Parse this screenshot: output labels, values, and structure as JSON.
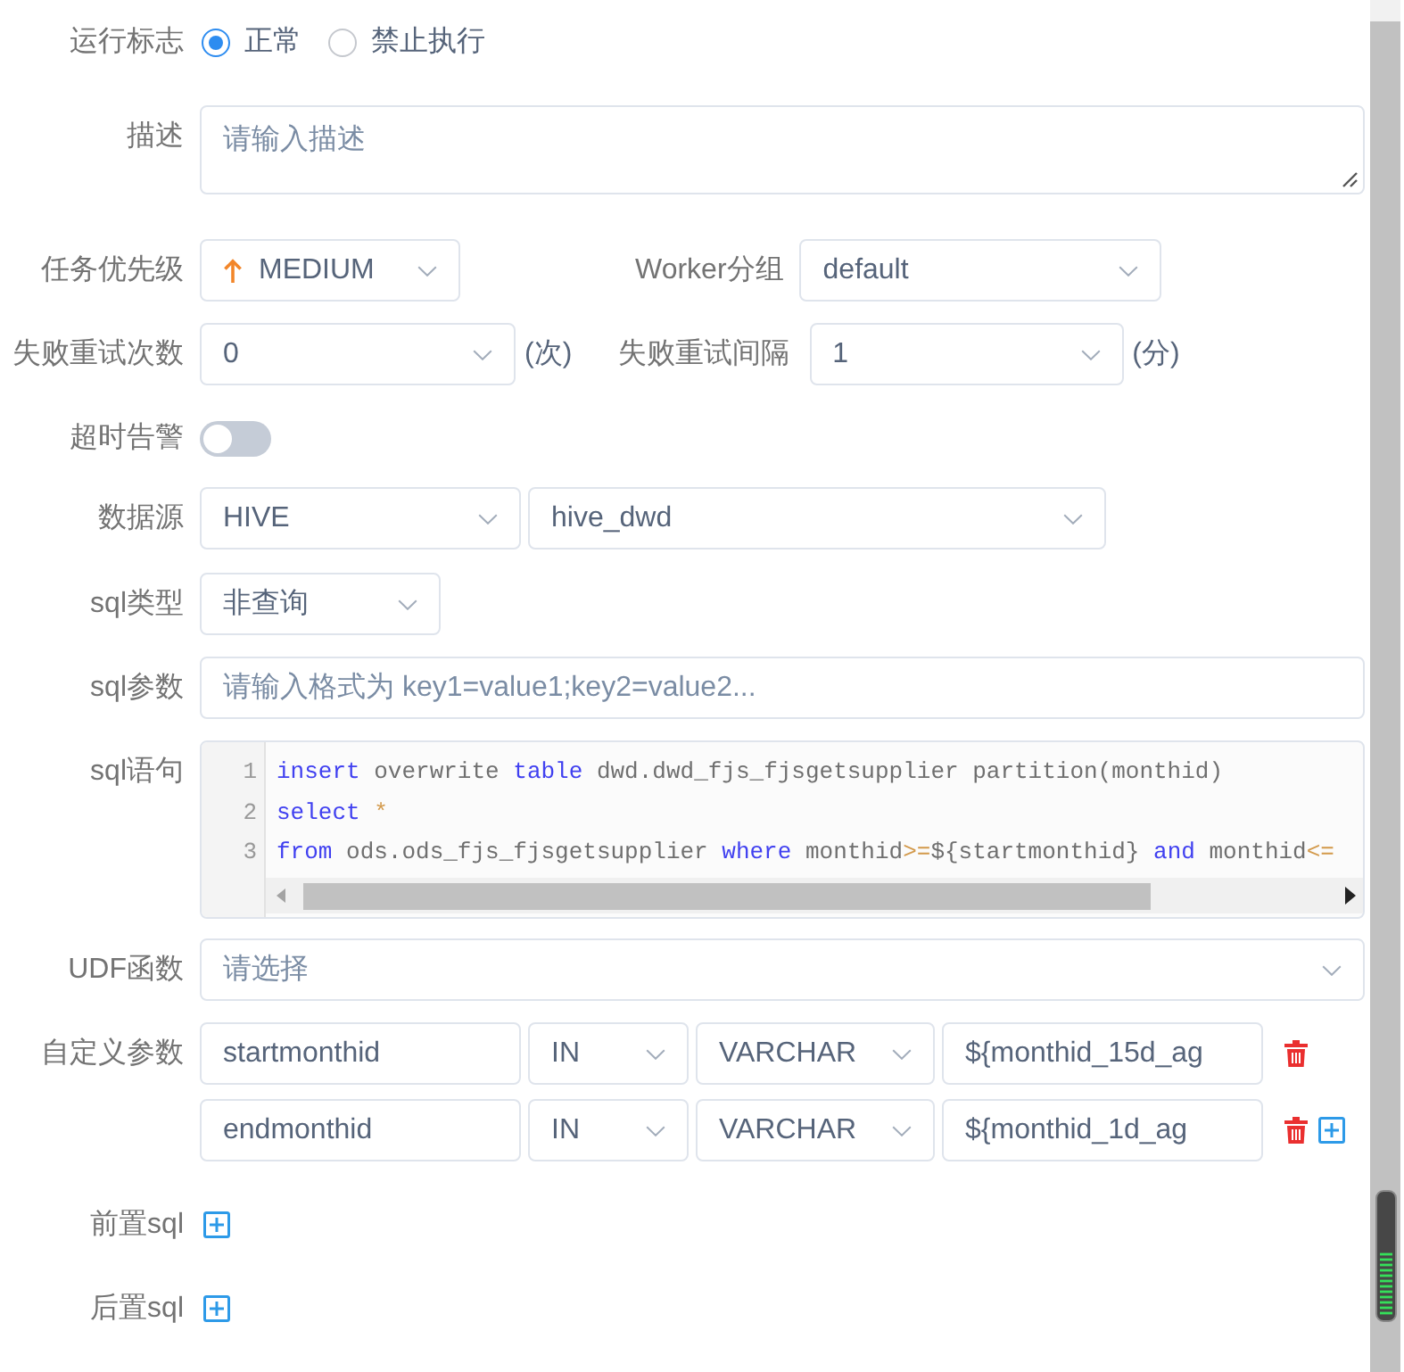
{
  "run_flag": {
    "label": "运行标志",
    "options": [
      {
        "label": "正常",
        "selected": true
      },
      {
        "label": "禁止执行",
        "selected": false
      }
    ]
  },
  "description": {
    "label": "描述",
    "placeholder": "请输入描述"
  },
  "task_priority": {
    "label": "任务优先级",
    "value": "MEDIUM"
  },
  "worker_group": {
    "label": "Worker分组",
    "value": "default"
  },
  "retry_times": {
    "label": "失败重试次数",
    "value": "0",
    "unit": "(次)"
  },
  "retry_interval": {
    "label": "失败重试间隔",
    "value": "1",
    "unit": "(分)"
  },
  "timeout_alarm": {
    "label": "超时告警",
    "on": false
  },
  "datasource": {
    "label": "数据源",
    "type": "HIVE",
    "name": "hive_dwd"
  },
  "sql_type": {
    "label": "sql类型",
    "value": "非查询"
  },
  "sql_params": {
    "label": "sql参数",
    "placeholder": "请输入格式为 key1=value1;key2=value2..."
  },
  "sql_statement": {
    "label": "sql语句",
    "lines": [
      {
        "number": "1",
        "tokens": [
          {
            "kind": "keyword",
            "text": "insert"
          },
          {
            "kind": "text",
            "text": " overwrite "
          },
          {
            "kind": "keyword",
            "text": "table"
          },
          {
            "kind": "text",
            "text": " dwd.dwd_fjs_fjsgetsupplier partition(monthid)"
          }
        ]
      },
      {
        "number": "2",
        "tokens": [
          {
            "kind": "keyword",
            "text": "select"
          },
          {
            "kind": "operator",
            "text": " *"
          }
        ]
      },
      {
        "number": "3",
        "tokens": [
          {
            "kind": "keyword",
            "text": "from"
          },
          {
            "kind": "text",
            "text": " ods.ods_fjs_fjsgetsupplier "
          },
          {
            "kind": "keyword",
            "text": "where"
          },
          {
            "kind": "text",
            "text": " monthid"
          },
          {
            "kind": "operator",
            "text": ">="
          },
          {
            "kind": "text",
            "text": "${startmonthid} "
          },
          {
            "kind": "keyword",
            "text": "and"
          },
          {
            "kind": "text",
            "text": " monthid"
          },
          {
            "kind": "operator",
            "text": "<="
          }
        ]
      }
    ]
  },
  "udf": {
    "label": "UDF函数",
    "placeholder": "请选择"
  },
  "custom_params": {
    "label": "自定义参数",
    "rows": [
      {
        "prop": "startmonthid",
        "direction": "IN",
        "type": "VARCHAR",
        "value": "${monthid_15d_ag"
      },
      {
        "prop": "endmonthid",
        "direction": "IN",
        "type": "VARCHAR",
        "value": "${monthid_1d_ag"
      }
    ]
  },
  "pre_sql": {
    "label": "前置sql"
  },
  "post_sql": {
    "label": "后置sql"
  }
}
